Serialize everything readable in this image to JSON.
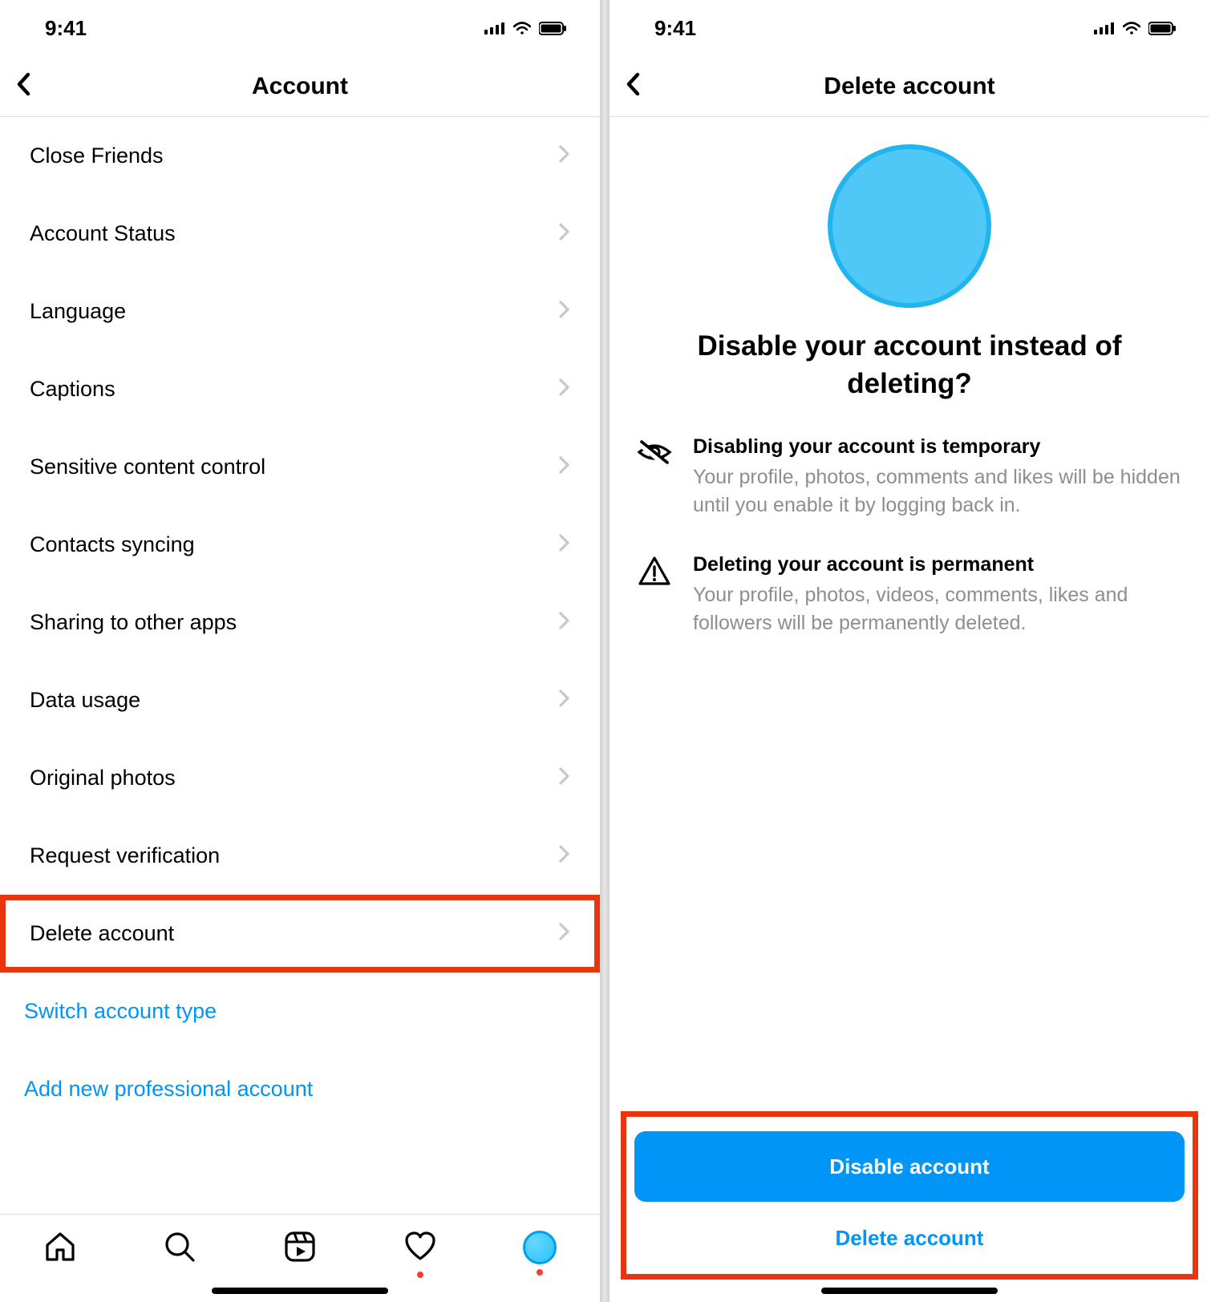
{
  "left": {
    "status_time": "9:41",
    "header_title": "Account",
    "rows": [
      {
        "label": "Close Friends"
      },
      {
        "label": "Account Status"
      },
      {
        "label": "Language"
      },
      {
        "label": "Captions"
      },
      {
        "label": "Sensitive content control"
      },
      {
        "label": "Contacts syncing"
      },
      {
        "label": "Sharing to other apps"
      },
      {
        "label": "Data usage"
      },
      {
        "label": "Original photos"
      },
      {
        "label": "Request verification"
      },
      {
        "label": "Delete account"
      }
    ],
    "links": {
      "switch": "Switch account type",
      "add_pro": "Add new professional account"
    }
  },
  "right": {
    "status_time": "9:41",
    "header_title": "Delete account",
    "headline": "Disable your account instead of deleting?",
    "blocks": {
      "disable_title": "Disabling your account is temporary",
      "disable_desc": "Your profile, photos, comments and likes will be hidden until you enable it by logging back in.",
      "delete_title": "Deleting your account is permanent",
      "delete_desc": "Your profile, photos, videos, comments, likes and followers will be permanently deleted."
    },
    "buttons": {
      "primary": "Disable account",
      "secondary": "Delete account"
    }
  }
}
